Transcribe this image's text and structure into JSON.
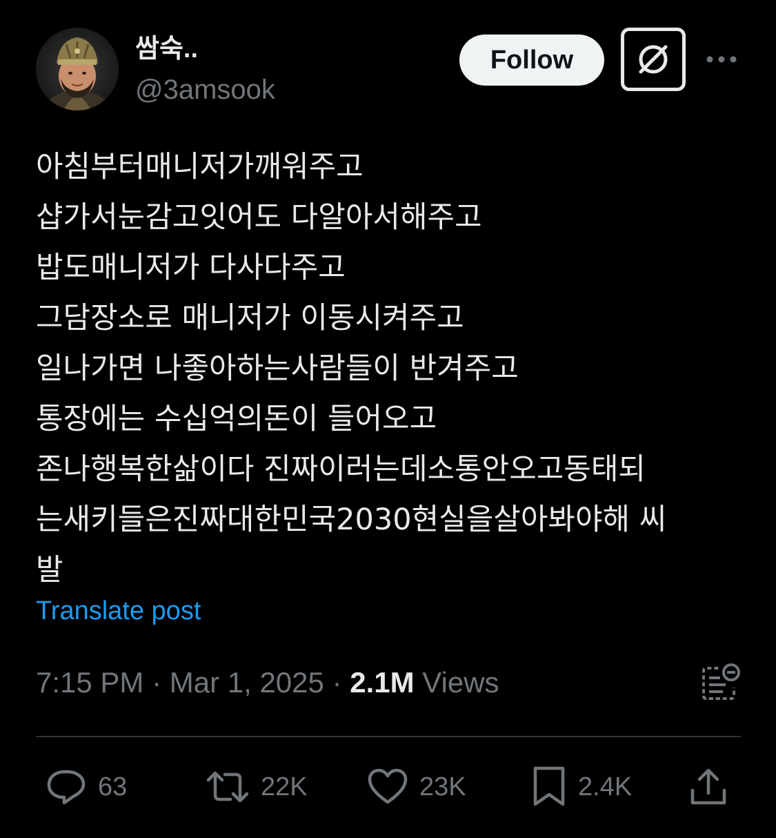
{
  "author": {
    "display_name": "쌈숙..",
    "handle": "@3amsook"
  },
  "header": {
    "follow_label": "Follow"
  },
  "tweet": {
    "lines": [
      "아침부터매니저가깨워주고",
      "샵가서눈감고잇어도 다알아서해주고",
      "밥도매니저가 다사다주고",
      "그담장소로 매니저가 이동시켜주고",
      "일나가면 나좋아하는사람들이 반겨주고",
      "통장에는 수십억의돈이 들어오고",
      "존나행복한삶이다 진짜이러는데소통안오고동태되",
      "는새키들은진짜대한민국2030현실을살아봐야해 씨",
      "발"
    ],
    "translate_label": "Translate post",
    "time": "7:15 PM",
    "separator": " · ",
    "date": "Mar 1, 2025",
    "views_count": "2.1M",
    "views_label": "Views"
  },
  "actions": {
    "replies": "63",
    "reposts": "22K",
    "likes": "23K",
    "bookmarks": "2.4K"
  },
  "icons": {
    "grok": "grok-icon",
    "more": "more-icon",
    "analytics": "analytics-icon",
    "reply": "reply-icon",
    "repost": "repost-icon",
    "like": "heart-icon",
    "bookmark": "bookmark-icon",
    "share": "share-icon"
  },
  "colors": {
    "background": "#000000",
    "text_primary": "#e7e9ea",
    "text_secondary": "#71767b",
    "link": "#1d9bf0",
    "divider": "#2f3336",
    "follow_bg": "#eff3f4"
  }
}
